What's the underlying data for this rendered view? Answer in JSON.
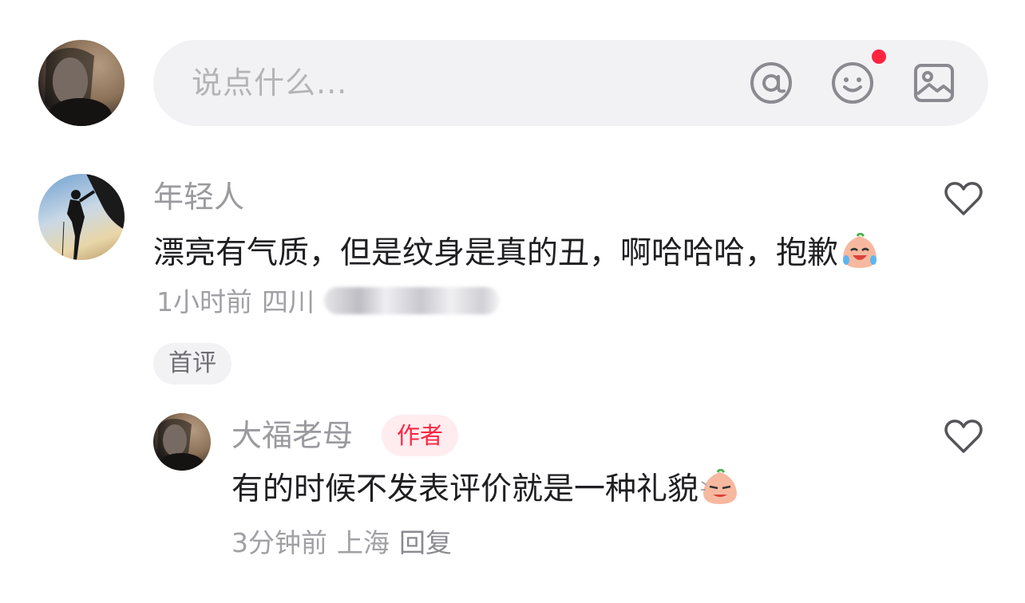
{
  "composer": {
    "placeholder": "说点什么...",
    "icons": [
      "at-icon",
      "emoji-icon",
      "image-icon"
    ],
    "emoji_notification_dot": true,
    "accent_color": "#ff2442"
  },
  "comments": [
    {
      "username": "年轻人",
      "text": "漂亮有气质，但是纹身是真的丑，啊哈哈哈，抱歉",
      "emoji": "laugh-cry-emoji",
      "time": "1小时前",
      "location": "四川",
      "badge": "首评",
      "liked": false
    }
  ],
  "reply": {
    "username": "大福老母",
    "author_badge": "作者",
    "text": "有的时候不发表评价就是一种礼貌",
    "emoji": "smirk-emoji",
    "time": "3分钟前",
    "location": "上海",
    "reply_label": "回复",
    "liked": false
  }
}
